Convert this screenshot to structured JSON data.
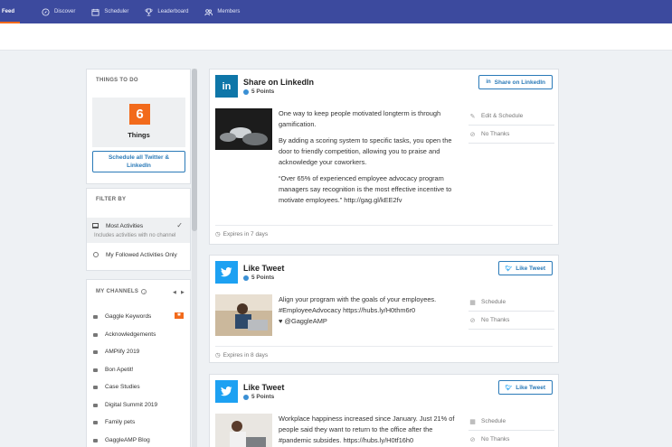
{
  "nav": {
    "items": [
      {
        "label": "Feed",
        "icon": "feed-icon"
      },
      {
        "label": "Discover",
        "icon": "compass-icon"
      },
      {
        "label": "Scheduler",
        "icon": "calendar-icon"
      },
      {
        "label": "Leaderboard",
        "icon": "trophy-icon"
      },
      {
        "label": "Members",
        "icon": "people-icon"
      }
    ]
  },
  "todo": {
    "title": "THINGS TO DO",
    "count": "6",
    "count_label": "Things",
    "schedule_button": "Schedule all Twitter & LinkedIn"
  },
  "filter": {
    "title": "FILTER BY",
    "options": [
      {
        "label": "Most Activities",
        "sublabel": "Includes activities with no channel",
        "selected": true
      },
      {
        "label": "My Followed Activities Only",
        "selected": false
      }
    ]
  },
  "channels": {
    "title": "MY CHANNELS",
    "items": [
      {
        "label": "Gaggle Keywords",
        "flag": true
      },
      {
        "label": "Acknowledgements"
      },
      {
        "label": "AMPlify 2019"
      },
      {
        "label": "Bon Apetit!"
      },
      {
        "label": "Case Studies"
      },
      {
        "label": "Digital Summit 2019"
      },
      {
        "label": "Family pets"
      },
      {
        "label": "GaggleAMP Blog"
      }
    ]
  },
  "cards": [
    {
      "title": "Share on LinkedIn",
      "points": "5 Points",
      "button": "Share on LinkedIn",
      "paragraphs": [
        "One way to keep people motivated longterm is through gamification.",
        "By adding a scoring system to specific tasks, you open the door to friendly competition, allowing you to praise and acknowledge your coworkers.",
        "“Over 65% of experienced employee advocacy program managers say recognition is the most effective incentive to motivate employees.” http://gag.gl/kEE2fv"
      ],
      "actions": [
        "Edit & Schedule",
        "No Thanks"
      ],
      "expires": "Expires in 7 days"
    },
    {
      "title": "Like Tweet",
      "points": "5 Points",
      "button": "Like Tweet",
      "paragraphs": [
        "Align your program with the goals of your employees. #EmployeeAdvocacy https://hubs.ly/H0thm6r0",
        "♥ @GaggleAMP"
      ],
      "actions": [
        "Schedule",
        "No Thanks"
      ],
      "expires": "Expires in 8 days"
    },
    {
      "title": "Like Tweet",
      "points": "5 Points",
      "button": "Like Tweet",
      "paragraphs": [
        "Workplace happiness increased since January. Just 21% of people said they want to return to the office after the #pandemic subsides. https://hubs.ly/H0tf16h0"
      ],
      "actions": [
        "Schedule",
        "No Thanks"
      ]
    }
  ],
  "colors": {
    "nav_bg": "#3c4a9e",
    "accent_orange": "#f26a1b",
    "link_blue": "#2a7ab8",
    "linkedin": "#0e76a8",
    "twitter": "#1da1f2"
  }
}
